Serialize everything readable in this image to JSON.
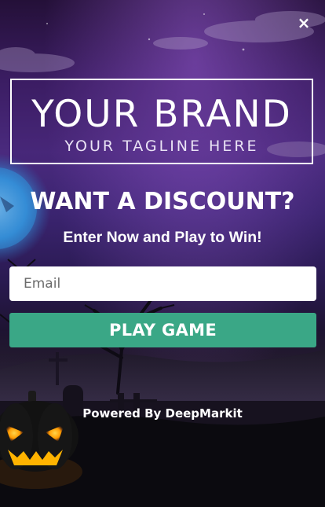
{
  "close": {
    "symbol": "×"
  },
  "brand": {
    "name": "YOUR BRAND",
    "tagline": "YOUR TAGLINE HERE"
  },
  "headline": "WANT A DISCOUNT?",
  "subheadline": "Enter Now and Play to Win!",
  "email": {
    "value": "",
    "placeholder": "Email"
  },
  "play_button": {
    "label": "PLAY GAME"
  },
  "footer": {
    "powered_by": "Powered By DeepMarkit"
  },
  "colors": {
    "button": "#3aa786",
    "background_top": "#3b1d63",
    "background_bottom": "#0a0910",
    "moon": "#2f8fd8",
    "pumpkin_glow": "#ffb300"
  },
  "icons": [
    "close-icon",
    "moon",
    "jack-o-lantern",
    "bare-tree",
    "graveyard-cross",
    "clouds"
  ]
}
